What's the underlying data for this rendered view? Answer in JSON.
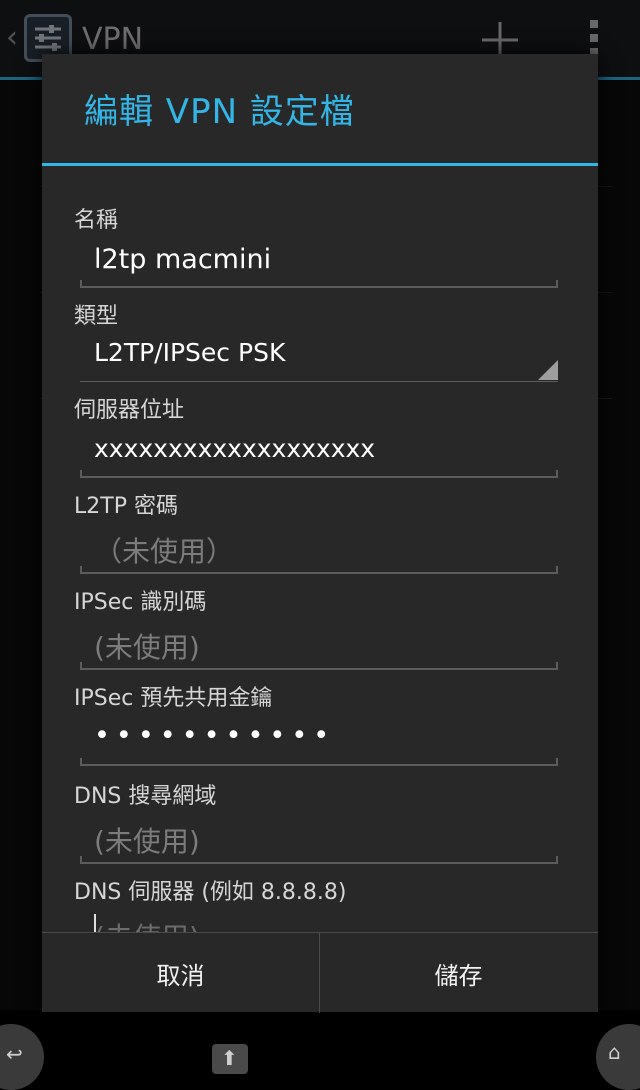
{
  "background": {
    "title": "VPN",
    "up_icon": "chevron-left-icon",
    "app_icon": "vpn-settings-icon",
    "add_icon": "plus-icon",
    "overflow_icon": "overflow-menu-icon"
  },
  "dialog": {
    "title": "編輯 VPN 設定檔",
    "fields": {
      "name": {
        "label": "名稱",
        "value": "l2tp macmini"
      },
      "type": {
        "label": "類型",
        "value": "L2TP/IPSec PSK"
      },
      "server": {
        "label": "伺服器位址",
        "value": "xxxxxxxxxxxxxxxxxxx"
      },
      "l2tp_secret": {
        "label": "L2TP 密碼",
        "placeholder": "（未使用）"
      },
      "ipsec_id": {
        "label": "IPSec 識別碼",
        "placeholder": "(未使用)"
      },
      "ipsec_psk": {
        "label": "IPSec 預先共用金鑰",
        "value": "•••••••••••"
      },
      "dns_search": {
        "label": "DNS 搜尋網域",
        "placeholder": "(未使用)"
      },
      "dns_servers": {
        "label": "DNS 伺服器 (例如 8.8.8.8)",
        "placeholder": "(未使用)"
      }
    },
    "buttons": {
      "cancel": "取消",
      "save": "儲存"
    }
  },
  "accent_color": "#33b5e5"
}
